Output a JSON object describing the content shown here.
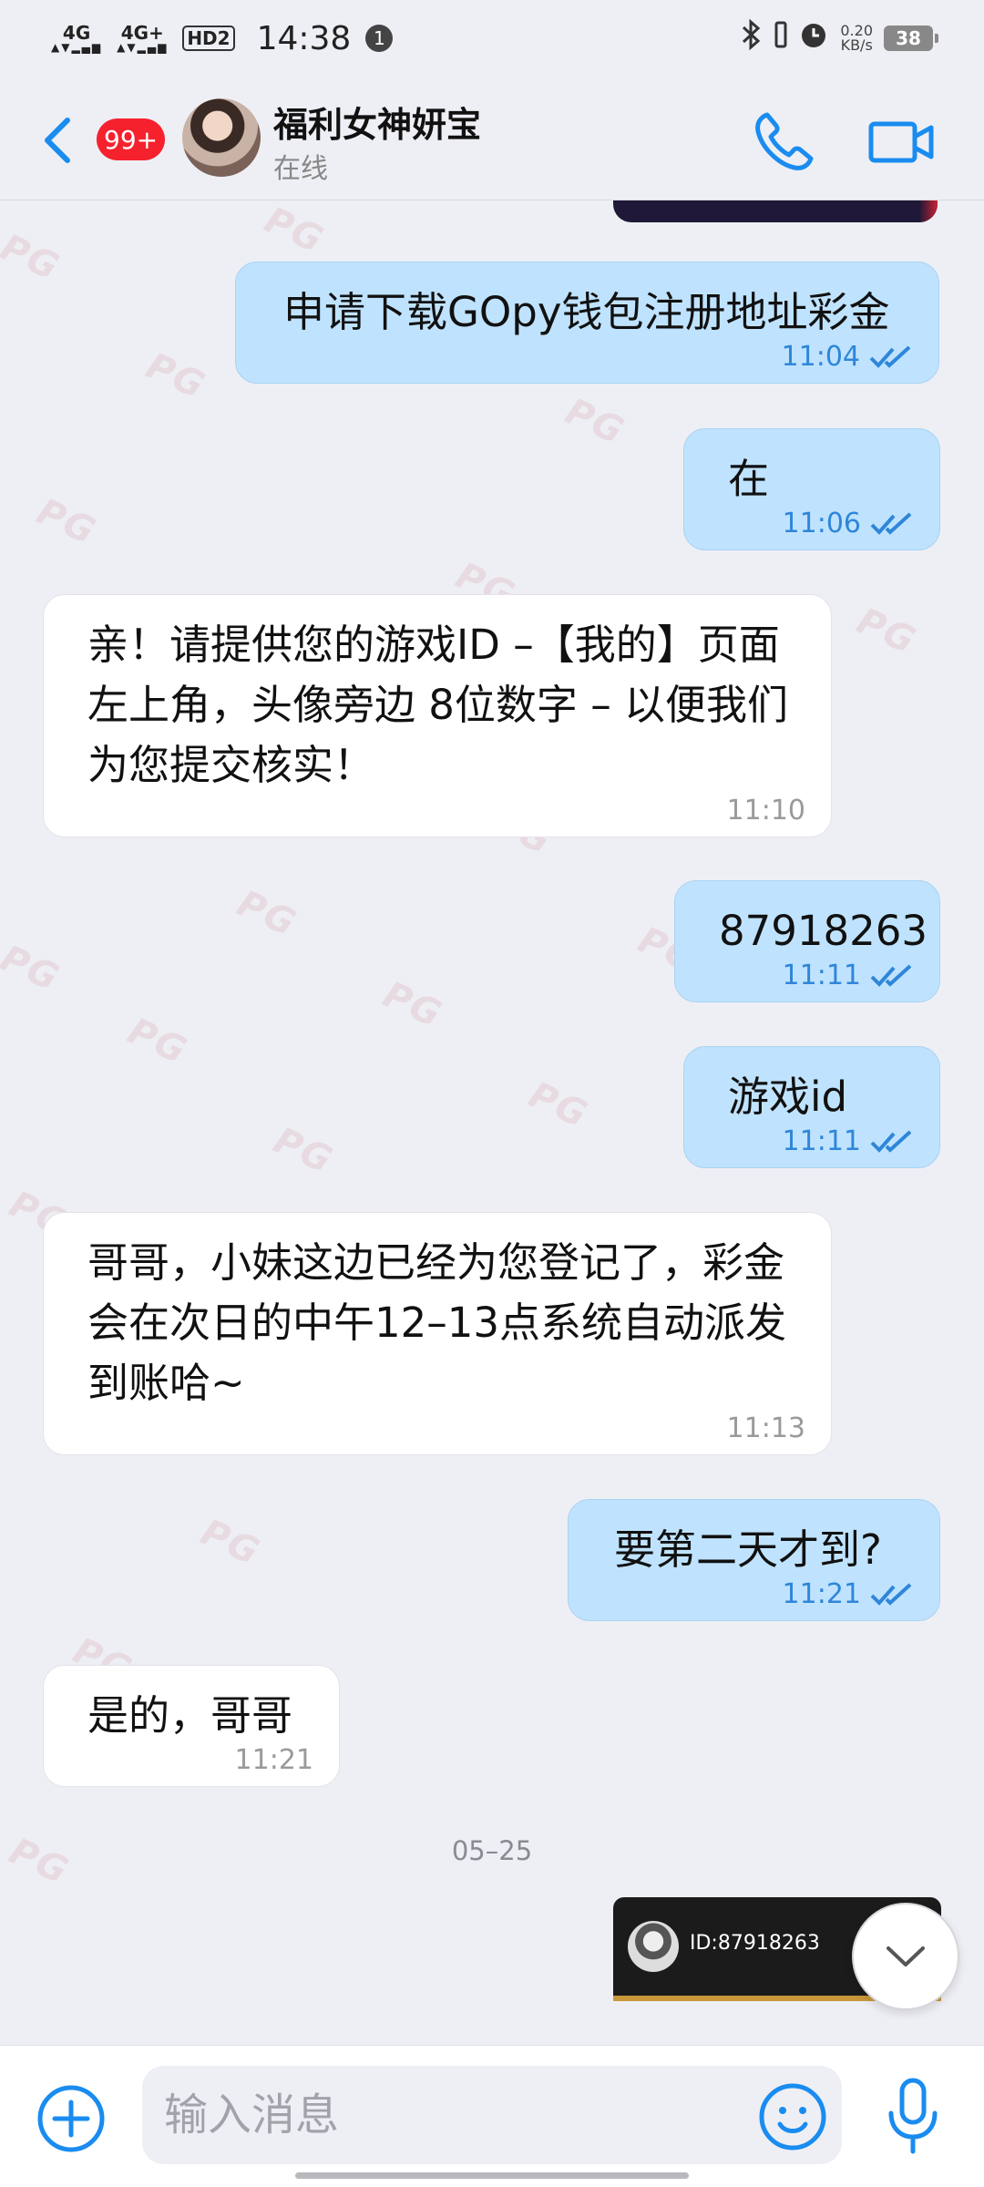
{
  "status_bar": {
    "net1": "4G",
    "net2": "4G+",
    "hd": "HD2",
    "time": "14:38",
    "notification_count": "1",
    "speed_value": "0.20",
    "speed_unit": "KB/s",
    "battery": "38"
  },
  "header": {
    "unread_badge": "99+",
    "contact_name": "福利女神妍宝",
    "presence": "在线"
  },
  "messages": [
    {
      "dir": "out",
      "text": "申请下载GOpy钱包注册地址彩金",
      "time": "11:04"
    },
    {
      "dir": "out",
      "text": "在",
      "time": "11:06"
    },
    {
      "dir": "in",
      "text": "亲！请提供您的游戏ID –【我的】页面左上角，头像旁边 8位数字 – 以便我们为您提交核实！",
      "time": "11:10"
    },
    {
      "dir": "out",
      "text": "87918263",
      "time": "11:11"
    },
    {
      "dir": "out",
      "text": "游戏id",
      "time": "11:11"
    },
    {
      "dir": "in",
      "text": "哥哥，小妹这边已经为您登记了，彩金会在次日的中午12–13点系统自动派发到账哈~",
      "time": "11:13"
    },
    {
      "dir": "out",
      "text": "要第二天才到?",
      "time": "11:21"
    },
    {
      "dir": "in",
      "text": "是的，哥哥",
      "time": "11:21"
    }
  ],
  "date_separator": "05–25",
  "id_card_text": "ID:87918263",
  "composer": {
    "placeholder": "输入消息"
  },
  "colors": {
    "outgoing_bubble": "#bfe3fe",
    "incoming_bubble": "#ffffff",
    "accent_blue": "#1a8cf0",
    "badge_red": "#f5222d"
  },
  "icons": {
    "back": "chevron-left-icon",
    "call": "phone-icon",
    "video": "video-camera-icon",
    "add": "plus-circle-icon",
    "emoji": "smiley-icon",
    "mic": "microphone-icon",
    "scroll": "chevron-down-icon",
    "read_receipt": "double-check-icon"
  }
}
